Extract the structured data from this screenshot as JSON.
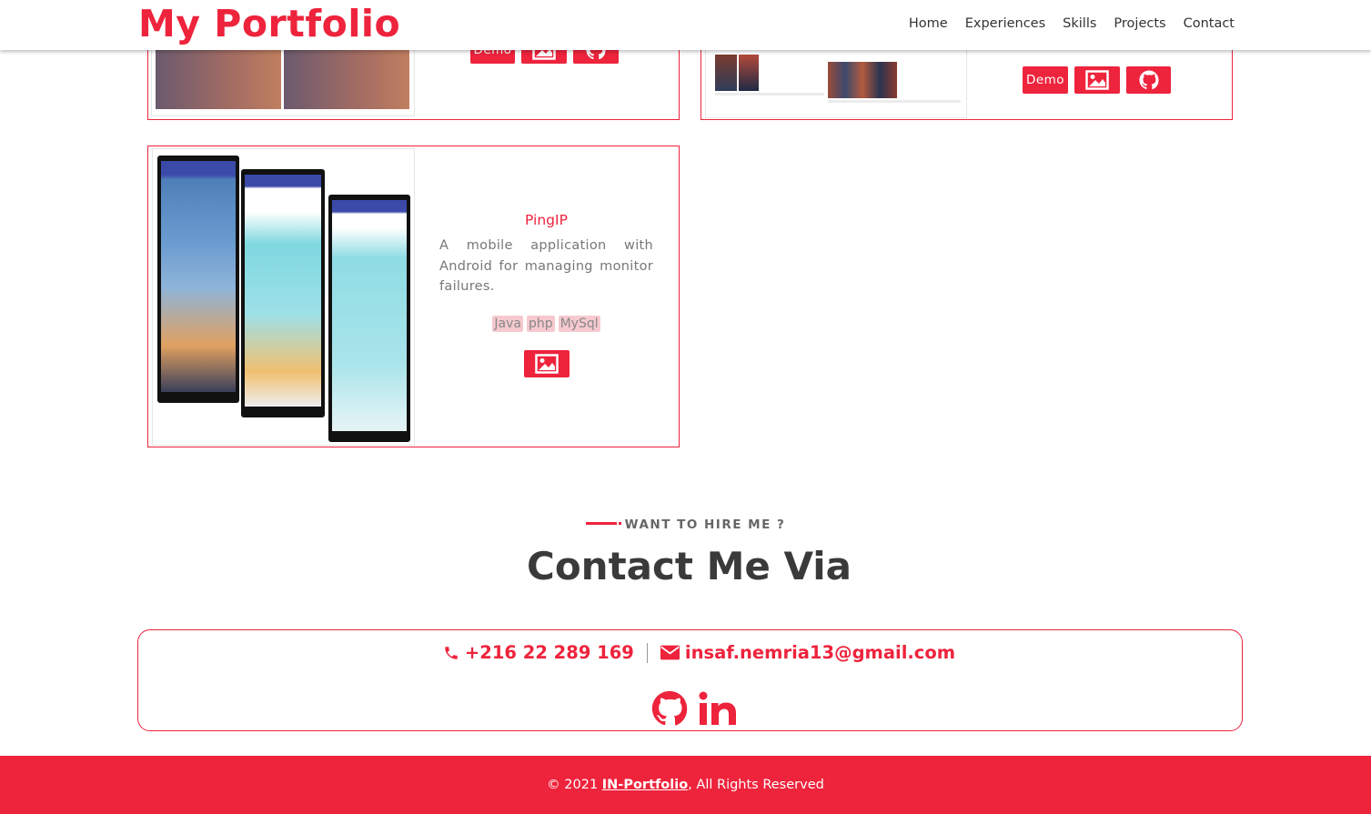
{
  "header": {
    "brand": "My Portfolio",
    "nav": [
      "Home",
      "Experiences",
      "Skills",
      "Projects",
      "Contact"
    ]
  },
  "projects": {
    "top_left": {
      "demo_label": "Demo"
    },
    "top_right": {
      "demo_label": "Demo"
    },
    "pingip": {
      "title": "PingIP",
      "description": "A mobile application with Android for managing monitor failures.",
      "tags": [
        "Java",
        "php",
        "MySql"
      ]
    }
  },
  "contact": {
    "eyebrow": "WANT TO HIRE ME ?",
    "title": "Contact Me Via",
    "phone": "+216 22 289 169",
    "email": "insaf.nemria13@gmail.com"
  },
  "footer": {
    "prefix": "© 2021 ",
    "link": "IN-Portfolio",
    "suffix": ", All Rights Reserved"
  },
  "icons": {
    "image": "image-icon",
    "github": "github-icon",
    "phone": "phone-icon",
    "email": "envelope-icon",
    "linkedin": "linkedin-icon"
  },
  "colors": {
    "accent": "#ee233c",
    "heading": "#3a3a3a",
    "tag_bg": "#f6c9cf"
  }
}
